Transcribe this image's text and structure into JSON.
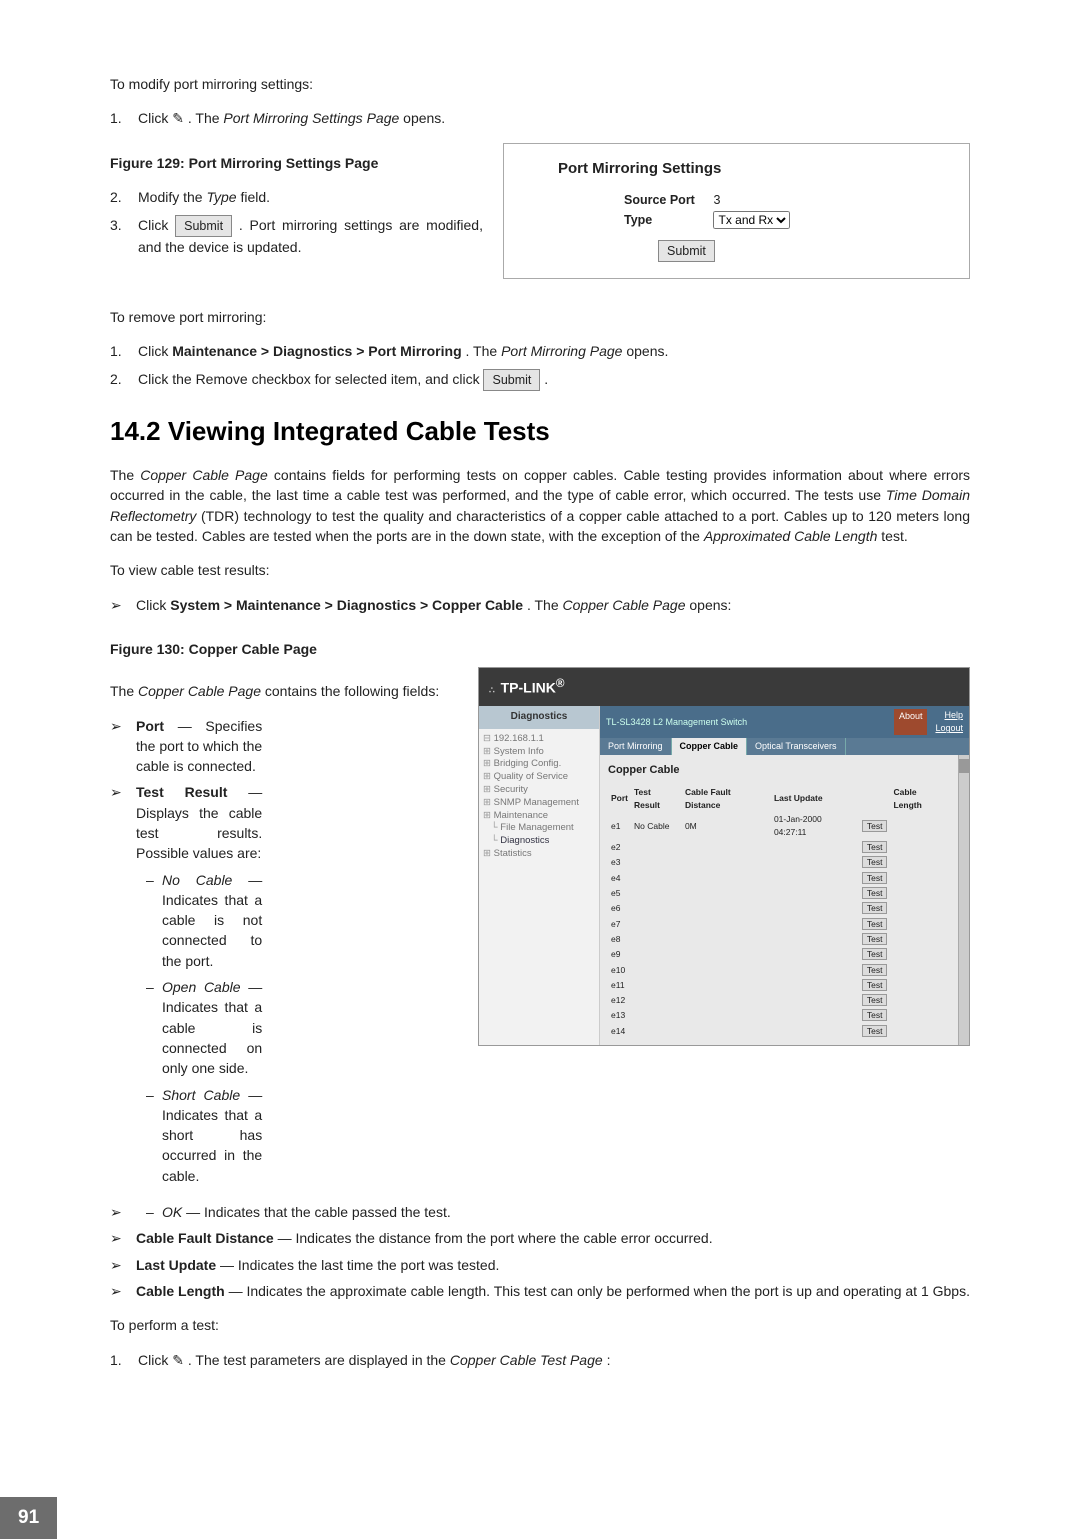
{
  "section_top": {
    "modify_intro": "To modify port mirroring settings:",
    "step1a": "Click ",
    "step1b": ". The ",
    "step1c": "Port Mirroring Settings Page",
    "step1d": " opens.",
    "fig129": "Figure 129: Port Mirroring Settings Page",
    "step2a": "Modify the ",
    "step2b": "Type",
    "step2c": " field.",
    "step3a": "Click ",
    "step3btn": "Submit",
    "step3b": ". Port mirroring settings are modified, and the device is updated.",
    "remove_intro": "To remove port mirroring:",
    "r1a": "Click ",
    "r1b": "Maintenance > Diagnostics > Port Mirroring",
    "r1c": ". The ",
    "r1d": "Port Mirroring Page",
    "r1e": " opens.",
    "r2a": "Click the Remove checkbox for selected item, and click ",
    "r2btn": "Submit",
    "r2b": "."
  },
  "settingsbox": {
    "title": "Port Mirroring Settings",
    "src_lbl": "Source Port",
    "src_val": "3",
    "type_lbl": "Type",
    "type_val": "Tx and Rx",
    "submit": "Submit"
  },
  "h2": "14.2   Viewing Integrated Cable Tests",
  "para1a": "The ",
  "para1b": "Copper Cable Page",
  "para1c": " contains fields for performing tests on copper cables. Cable testing provides information about where errors occurred in the cable, the last time a cable test was performed, and the type of cable error, which occurred. The tests use ",
  "para1d": "Time Domain Reflectometry",
  "para1e": " (TDR) technology to test the quality and characteristics of a copper cable attached to a port. Cables up to 120 meters long can be tested. Cables are tested when the ports are in the down state, with the exception of the ",
  "para1f": "Approximated Cable Length",
  "para1g": " test.",
  "view_intro": "To view cable test results:",
  "view1a": "Click ",
  "view1b": "System > Maintenance > Diagnostics > Copper Cable",
  "view1c": ". The ",
  "view1d": "Copper Cable Page",
  "view1e": " opens:",
  "fig130": "Figure 130: Copper Cable Page",
  "fields_intro_a": "The ",
  "fields_intro_b": "Copper Cable Page",
  "fields_intro_c": " contains the following fields:",
  "fields": {
    "port": {
      "t": "Port",
      "d": " — Specifies the port to which the cable is connected."
    },
    "test_result": {
      "t": "Test Result",
      "d": " — Displays the cable test results. Possible values are:"
    },
    "no_cable": {
      "t": "No Cable",
      "d": " — Indicates that a cable is not connected to the port."
    },
    "open_cable": {
      "t": "Open Cable",
      "d": " — Indicates that a cable is connected on only one side."
    },
    "short_cable": {
      "t": "Short Cable",
      "d": " — Indicates that a short has occurred in the cable."
    },
    "ok": {
      "t": "OK",
      "d": " — Indicates that the cable passed the test."
    },
    "cfd": {
      "t": "Cable Fault Distance",
      "d": " — Indicates the distance from the port where the cable error occurred."
    },
    "lu": {
      "t": "Last Update",
      "d": " — Indicates the last time the port was tested."
    },
    "cl": {
      "t": "Cable Length",
      "d": " — Indicates the approximate cable length. This test can only be performed when the port is up and operating at 1 Gbps."
    }
  },
  "perform_intro": "To perform a test:",
  "p1a": "Click ",
  "p1b": ". The test parameters are displayed in the ",
  "p1c": "Copper Cable Test Page",
  "p1d": ":",
  "pagenum": "91",
  "ui": {
    "brand": "TP-LINK",
    "sidebar_title": "Diagnostics",
    "tree": [
      "192.168.1.1",
      "System Info",
      "Bridging Config.",
      "Quality of Service",
      "Security",
      "SNMP Management",
      "Maintenance",
      "  File Management",
      "  Diagnostics",
      "Statistics"
    ],
    "header_line": "TL-SL3428 L2 Management Switch",
    "about": "About",
    "help": "Help",
    "logout": "Logout",
    "tabs": [
      "Port Mirroring",
      "Copper Cable",
      "Optical Transceivers"
    ],
    "panel_title": "Copper Cable",
    "cols": [
      "Port",
      "Test Result",
      "Cable Fault Distance",
      "Last Update",
      "",
      "Cable Length"
    ],
    "rows": [
      {
        "p": "e1",
        "r": "No Cable",
        "d": "0M",
        "u": "01-Jan-2000 04:27:11"
      },
      {
        "p": "e2"
      },
      {
        "p": "e3"
      },
      {
        "p": "e4"
      },
      {
        "p": "e5"
      },
      {
        "p": "e6"
      },
      {
        "p": "e7"
      },
      {
        "p": "e8"
      },
      {
        "p": "e9"
      },
      {
        "p": "e10"
      },
      {
        "p": "e11"
      },
      {
        "p": "e12"
      },
      {
        "p": "e13"
      },
      {
        "p": "e14"
      }
    ],
    "test_btn": "Test"
  }
}
